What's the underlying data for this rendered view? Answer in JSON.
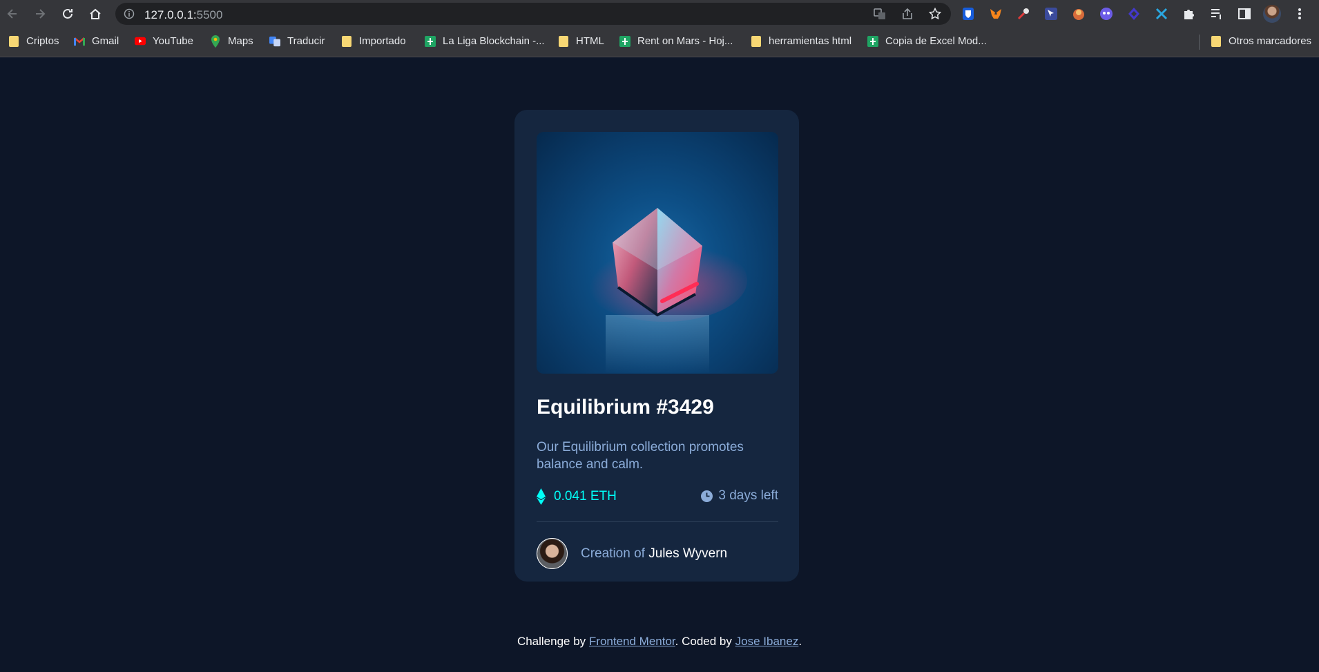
{
  "browser": {
    "url_host": "127.0.0.1:",
    "url_port": "5500",
    "bookmarks": [
      {
        "label": "Criptos",
        "icon": "folder-icon"
      },
      {
        "label": "Gmail",
        "icon": "gmail-icon"
      },
      {
        "label": "YouTube",
        "icon": "youtube-icon"
      },
      {
        "label": "Maps",
        "icon": "maps-icon"
      },
      {
        "label": "Traducir",
        "icon": "translate-icon"
      },
      {
        "label": "Importado",
        "icon": "folder-icon"
      },
      {
        "label": "La Liga Blockchain -...",
        "icon": "sheets-icon"
      },
      {
        "label": "HTML",
        "icon": "folder-icon"
      },
      {
        "label": "Rent on Mars - Hoj...",
        "icon": "sheets-icon"
      },
      {
        "label": "herramientas html",
        "icon": "folder-icon"
      },
      {
        "label": "Copia de Excel Mod...",
        "icon": "sheets-icon"
      }
    ],
    "other_bookmarks": "Otros marcadores"
  },
  "card": {
    "title": "Equilibrium #3429",
    "description": "Our Equilibrium collection promotes balance and calm.",
    "price": "0.041 ETH",
    "time_left": "3 days left",
    "creator_prefix": "Creation of",
    "creator_name": "Jules Wyvern"
  },
  "footer": {
    "challenge_by": "Challenge by",
    "challenge_link": "Frontend Mentor",
    "coded_by": ". Coded by",
    "author_link": "Jose Ibanez",
    "end": "."
  },
  "colors": {
    "page_bg": "#0d1628",
    "card_bg": "#15263f",
    "cyan": "#00fff8",
    "soft_blue": "#8bacd9"
  }
}
